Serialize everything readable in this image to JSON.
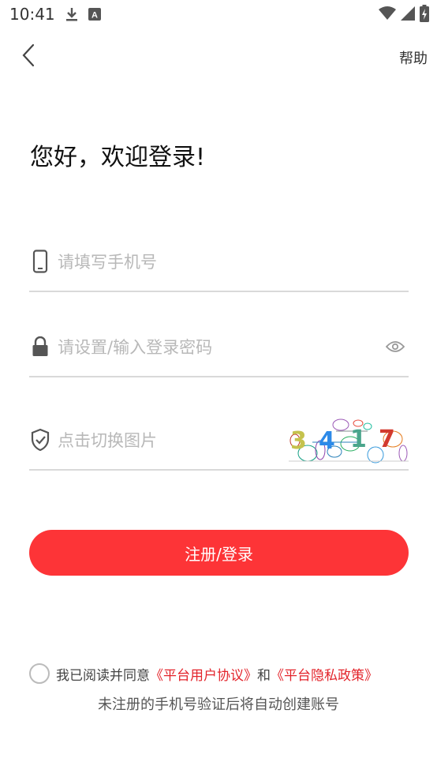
{
  "status_bar": {
    "time": "10:41",
    "icons_left": [
      "download-icon",
      "a-notification-icon"
    ],
    "icons_right": [
      "wifi-icon",
      "signal-icon",
      "battery-charging-icon"
    ]
  },
  "header": {
    "back_icon": "chevron-left-icon",
    "help_label": "帮助"
  },
  "title": "您好，欢迎登录!",
  "fields": {
    "phone": {
      "placeholder": "请填写手机号",
      "icon": "phone-icon"
    },
    "password": {
      "placeholder": "请设置/输入登录密码",
      "icon": "lock-icon",
      "toggle_icon": "eye-icon"
    },
    "captcha": {
      "placeholder": "点击切换图片",
      "icon": "shield-check-icon",
      "captcha_text": [
        "3",
        "4",
        "1",
        "7"
      ]
    }
  },
  "primary_button": "注册/登录",
  "agreement": {
    "prefix": "我已阅读并同意",
    "user_agreement": "《平台用户协议》",
    "conjunction": "和",
    "privacy_policy": "《平台隐私政策》"
  },
  "note": "未注册的手机号验证后将自动创建账号",
  "colors": {
    "accent": "#fd3437",
    "link": "#e3242b",
    "placeholder": "#b8b8b8",
    "divider": "#d9d9d9"
  }
}
